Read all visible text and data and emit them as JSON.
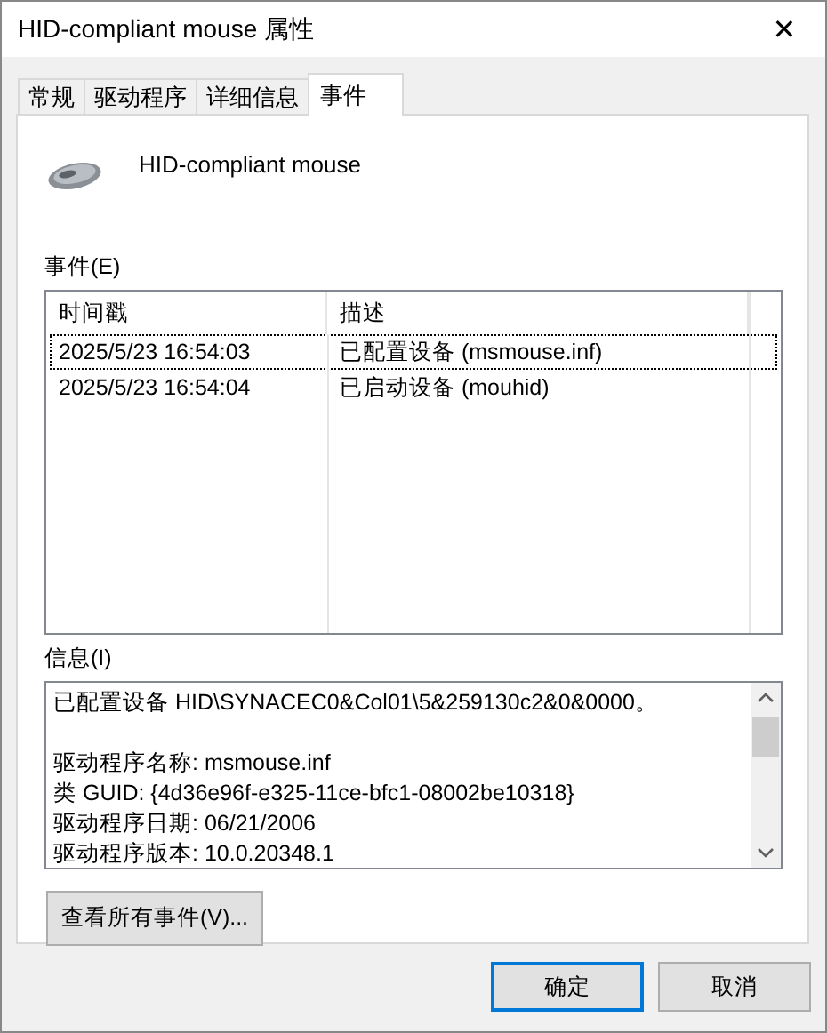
{
  "window": {
    "title": "HID-compliant mouse 属性",
    "close": "✕"
  },
  "tabs": [
    {
      "label": "常规",
      "selected": false
    },
    {
      "label": "驱动程序",
      "selected": false
    },
    {
      "label": "详细信息",
      "selected": false
    },
    {
      "label": "事件",
      "selected": true
    }
  ],
  "device": {
    "name": "HID-compliant mouse"
  },
  "events": {
    "label": "事件(E)",
    "columns": [
      "时间戳",
      "描述"
    ],
    "rows": [
      {
        "cells": [
          "2025/5/23 16:54:03",
          "已配置设备 (msmouse.inf)"
        ],
        "focused": true
      },
      {
        "cells": [
          "2025/5/23 16:54:04",
          "已启动设备 (mouhid)"
        ],
        "focused": false
      }
    ]
  },
  "info": {
    "label": "信息(I)",
    "paragraphs": [
      [
        "已配置设备 HID\\SYNACEC0&Col01\\5&259130c2&0&0000。"
      ],
      [
        "驱动程序名称: msmouse.inf",
        "类 GUID: {4d36e96f-e325-11ce-bfc1-08002be10318}",
        "驱动程序日期: 06/21/2006",
        "驱动程序版本: 10.0.20348.1"
      ]
    ]
  },
  "view_all_button": "查看所有事件(V)...",
  "buttons": [
    {
      "label": "确定",
      "default": true
    },
    {
      "label": "取消",
      "default": false
    }
  ]
}
